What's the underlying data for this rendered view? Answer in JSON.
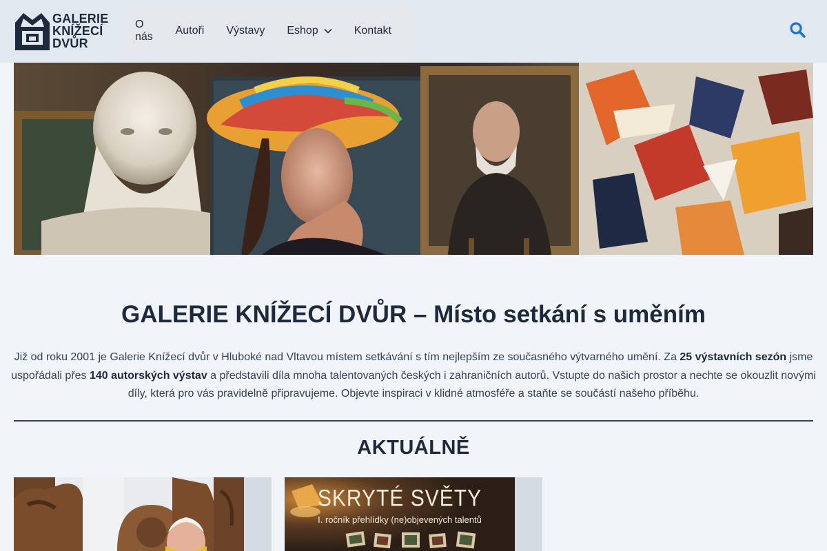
{
  "header": {
    "logo": {
      "line1": "GALERIE",
      "line2": "KNÍŽECÍ",
      "line3": "DVŮR",
      "icon": "crown-logo-icon"
    },
    "nav": [
      {
        "label": "O nás"
      },
      {
        "label": "Autoři"
      },
      {
        "label": "Výstavy"
      },
      {
        "label": "Eshop",
        "has_dropdown": true
      },
      {
        "label": "Kontakt"
      }
    ],
    "search_icon": "search-icon",
    "accent_color": "#1e6fd9"
  },
  "hero": {
    "image": "gallery-artworks-banner"
  },
  "intro": {
    "title": "GALERIE KNÍŽECÍ DVŮR – Místo setkání s uměním",
    "p1": "Již od roku 2001 je Galerie Knížecí dvůr v Hluboké nad Vltavou místem setkávání s tím nejlepším ze současného výtvarného umění. Za ",
    "b1": "25 výstavních sezón",
    "p2": " jsme uspořádali přes ",
    "b2": "140 autorských výstav",
    "p3": " a představili díla mnoha talentovaných českých i zahraničních autorů. Vstupte do našich prostor a nechte se okouzlit novými díly, která pro vás pravidelně připravujeme. Objevte inspiraci v klidné atmosféře a staňte se součástí našeho příběhu."
  },
  "news": {
    "title": "AKTUÁLNĚ",
    "cards": [
      {
        "image": "artist-with-wooden-sculpture"
      },
      {
        "image": "exhibition-poster",
        "poster_title": "SKRYTÉ SVĚTY",
        "poster_subtitle": "I. ročník přehlídky (ne)objevených talentů"
      }
    ]
  }
}
